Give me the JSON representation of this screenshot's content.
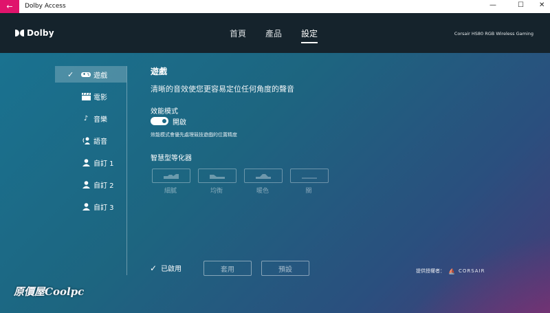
{
  "window": {
    "title": "Dolby Access",
    "back_label": "←",
    "min": "—",
    "max": "☐",
    "close": "✕"
  },
  "header": {
    "logo_text": "Dolby",
    "nav": [
      "首頁",
      "產品",
      "設定"
    ],
    "active_nav": "設定",
    "device": "Corsair HS80 RGB Wireless Gaming"
  },
  "sidebar": {
    "items": [
      {
        "label": "遊戲",
        "icon": "gamepad-icon",
        "active": true
      },
      {
        "label": "電影",
        "icon": "clapperboard-icon",
        "active": false
      },
      {
        "label": "音樂",
        "icon": "music-note-icon",
        "active": false
      },
      {
        "label": "語音",
        "icon": "voice-icon",
        "active": false
      },
      {
        "label": "自訂 1",
        "icon": "person-icon",
        "active": false
      },
      {
        "label": "自訂 2",
        "icon": "person-icon",
        "active": false
      },
      {
        "label": "自訂 3",
        "icon": "person-icon",
        "active": false
      }
    ]
  },
  "content": {
    "title": "遊戲",
    "subtitle": "清晰的音效使您更容易定位任何角度的聲音",
    "performance_label": "效能模式",
    "toggle_state": "開啟",
    "performance_desc": "效能模式會優先處理競技遊戲的位置精度",
    "eq_title": "智慧型等化器",
    "eq_presets": [
      "細膩",
      "均衡",
      "暖色",
      "關"
    ]
  },
  "footer": {
    "enabled_label": "已啟用",
    "apply_button": "套用",
    "default_button": "預設",
    "provided_by": "提供授權者：",
    "brand": "CORSAIR"
  },
  "watermark": "原價屋Coolpc",
  "colors": {
    "accent": "#e0146c",
    "header_bg": "#15232c"
  }
}
